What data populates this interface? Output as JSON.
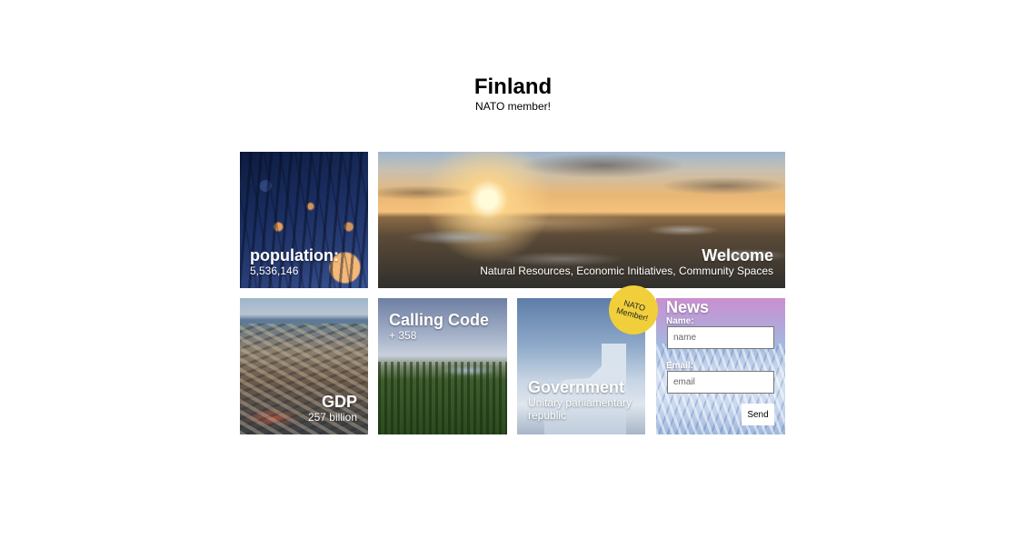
{
  "header": {
    "title": "Finland",
    "subtitle": "NATO member!"
  },
  "tiles": {
    "population": {
      "title": "population:",
      "value": "5,536,146"
    },
    "welcome": {
      "title": "Welcome",
      "subtitle": "Natural Resources, Economic Initiatives, Community Spaces"
    },
    "gdp": {
      "title": "GDP",
      "value": "257 billion"
    },
    "calling_code": {
      "title": "Calling Code",
      "value": "+ 358"
    },
    "government": {
      "title": "Government",
      "value": "Unitary parliamentary republic"
    },
    "news": {
      "title": "News",
      "name_label": "Name:",
      "name_placeholder": "name",
      "email_label": "Email:",
      "email_placeholder": "email",
      "send_label": "Send"
    }
  },
  "badge": {
    "line1": "NATO",
    "line2": "Member!",
    "color": "#f0cf3a"
  }
}
